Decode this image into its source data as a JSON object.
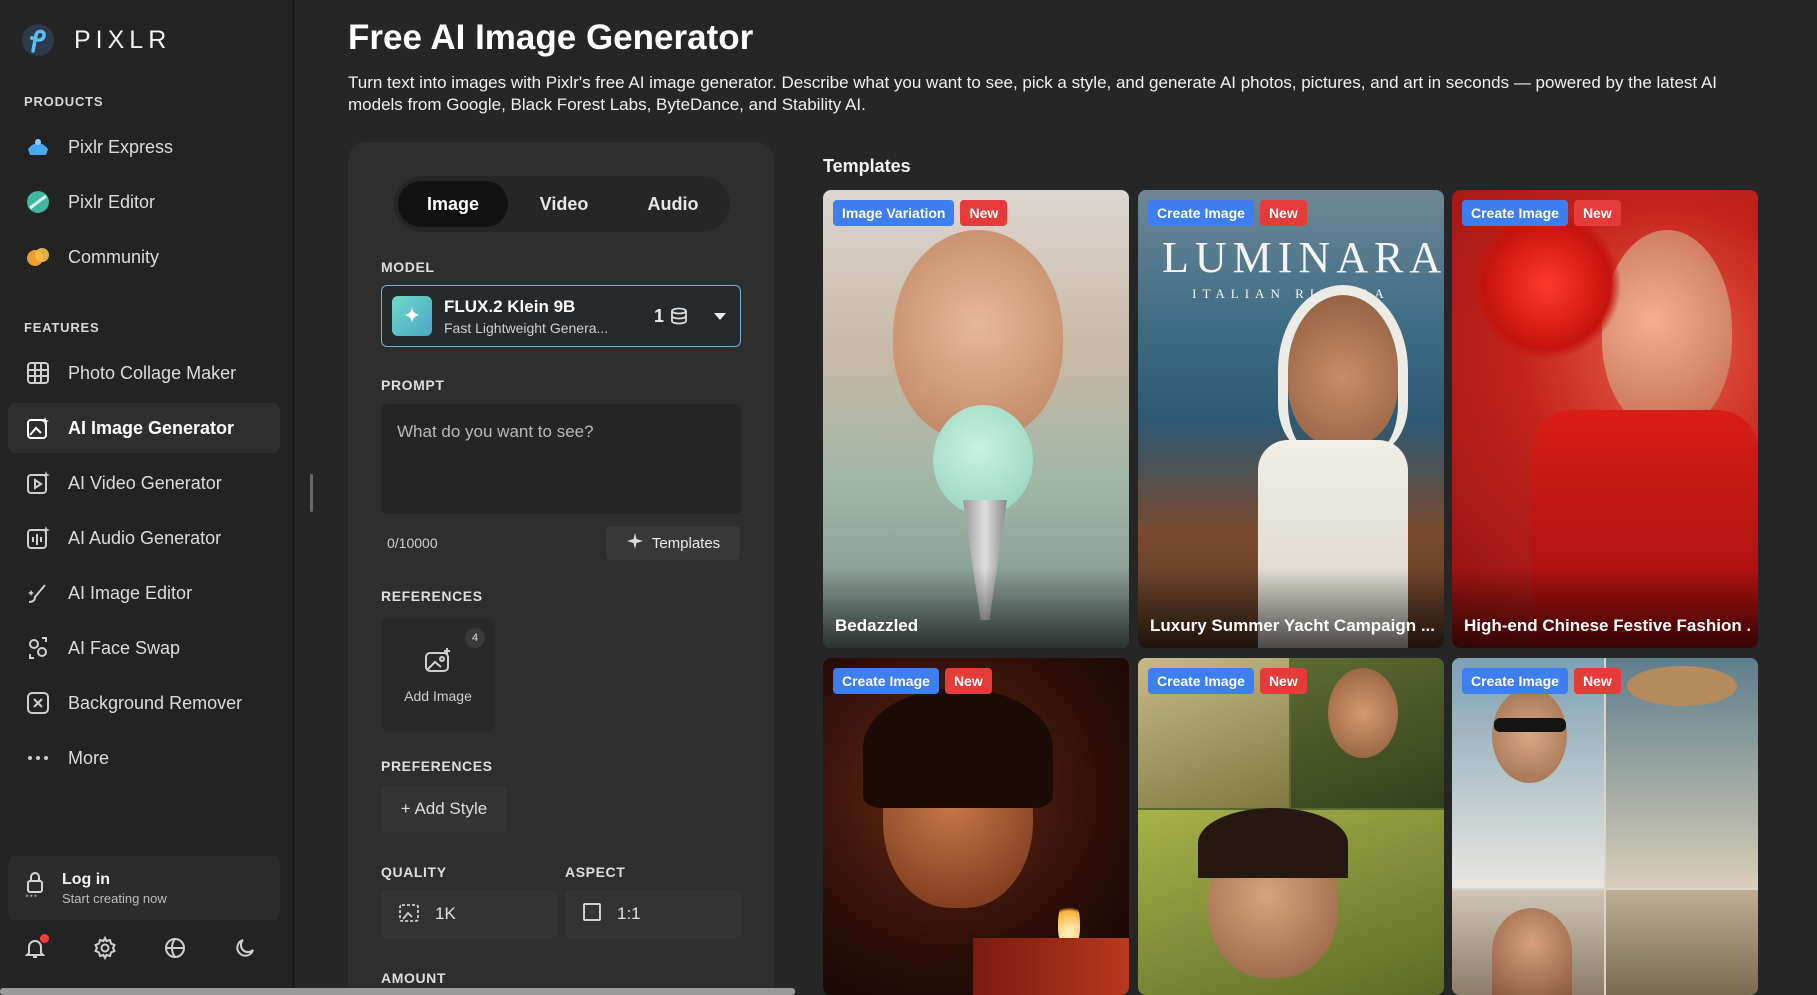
{
  "brand": {
    "name": "PIXLR"
  },
  "sidebar": {
    "products_label": "PRODUCTS",
    "products": [
      {
        "label": "Pixlr Express",
        "icon": "pixlr-express-icon"
      },
      {
        "label": "Pixlr Editor",
        "icon": "pixlr-editor-icon"
      },
      {
        "label": "Community",
        "icon": "community-icon"
      }
    ],
    "features_label": "FEATURES",
    "features": [
      {
        "label": "Photo Collage Maker",
        "icon": "collage-grid-icon"
      },
      {
        "label": "AI Image Generator",
        "icon": "image-sparkle-icon",
        "active": true
      },
      {
        "label": "AI Video Generator",
        "icon": "video-sparkle-icon"
      },
      {
        "label": "AI Audio Generator",
        "icon": "audio-sparkle-icon"
      },
      {
        "label": "AI Image Editor",
        "icon": "brush-sparkle-icon"
      },
      {
        "label": "AI Face Swap",
        "icon": "face-swap-icon"
      },
      {
        "label": "Background Remover",
        "icon": "background-remover-icon"
      },
      {
        "label": "More",
        "icon": "more-dots-icon"
      }
    ],
    "login": {
      "title": "Log in",
      "subtitle": "Start creating now"
    }
  },
  "header": {
    "title": "Free AI Image Generator",
    "description": "Turn text into images with Pixlr's free AI image generator. Describe what you want to see, pick a style, and generate AI photos, pictures, and art in seconds — powered by the latest AI models from Google, Black Forest Labs, ByteDance, and Stability AI."
  },
  "panel": {
    "tabs": [
      "Image",
      "Video",
      "Audio"
    ],
    "active_tab": "Image",
    "model_label": "MODEL",
    "model": {
      "name": "FLUX.2 Klein 9B",
      "subtitle": "Fast Lightweight Genera...",
      "credits": "1"
    },
    "prompt_label": "PROMPT",
    "prompt_placeholder": "What do you want to see?",
    "char_count": "0/10000",
    "templates_button": "Templates",
    "references_label": "REFERENCES",
    "references": {
      "add_label": "Add Image",
      "count": "4"
    },
    "preferences_label": "PREFERENCES",
    "add_style": "+ Add Style",
    "quality_label": "QUALITY",
    "quality_value": "1K",
    "aspect_label": "ASPECT",
    "aspect_value": "1:1",
    "amount_label": "AMOUNT"
  },
  "templates": {
    "heading": "Templates",
    "cards": [
      {
        "type": "Image Variation",
        "badge": "New",
        "title": "Bedazzled"
      },
      {
        "type": "Create Image",
        "badge": "New",
        "title": "Luxury Summer Yacht Campaign ...",
        "overlay_text": "LUMINARA",
        "overlay_sub": "ITALIAN RIVIERA"
      },
      {
        "type": "Create Image",
        "badge": "New",
        "title": "High-end Chinese Festive Fashion ..."
      },
      {
        "type": "Create Image",
        "badge": "New"
      },
      {
        "type": "Create Image",
        "badge": "New"
      },
      {
        "type": "Create Image",
        "badge": "New"
      }
    ]
  }
}
